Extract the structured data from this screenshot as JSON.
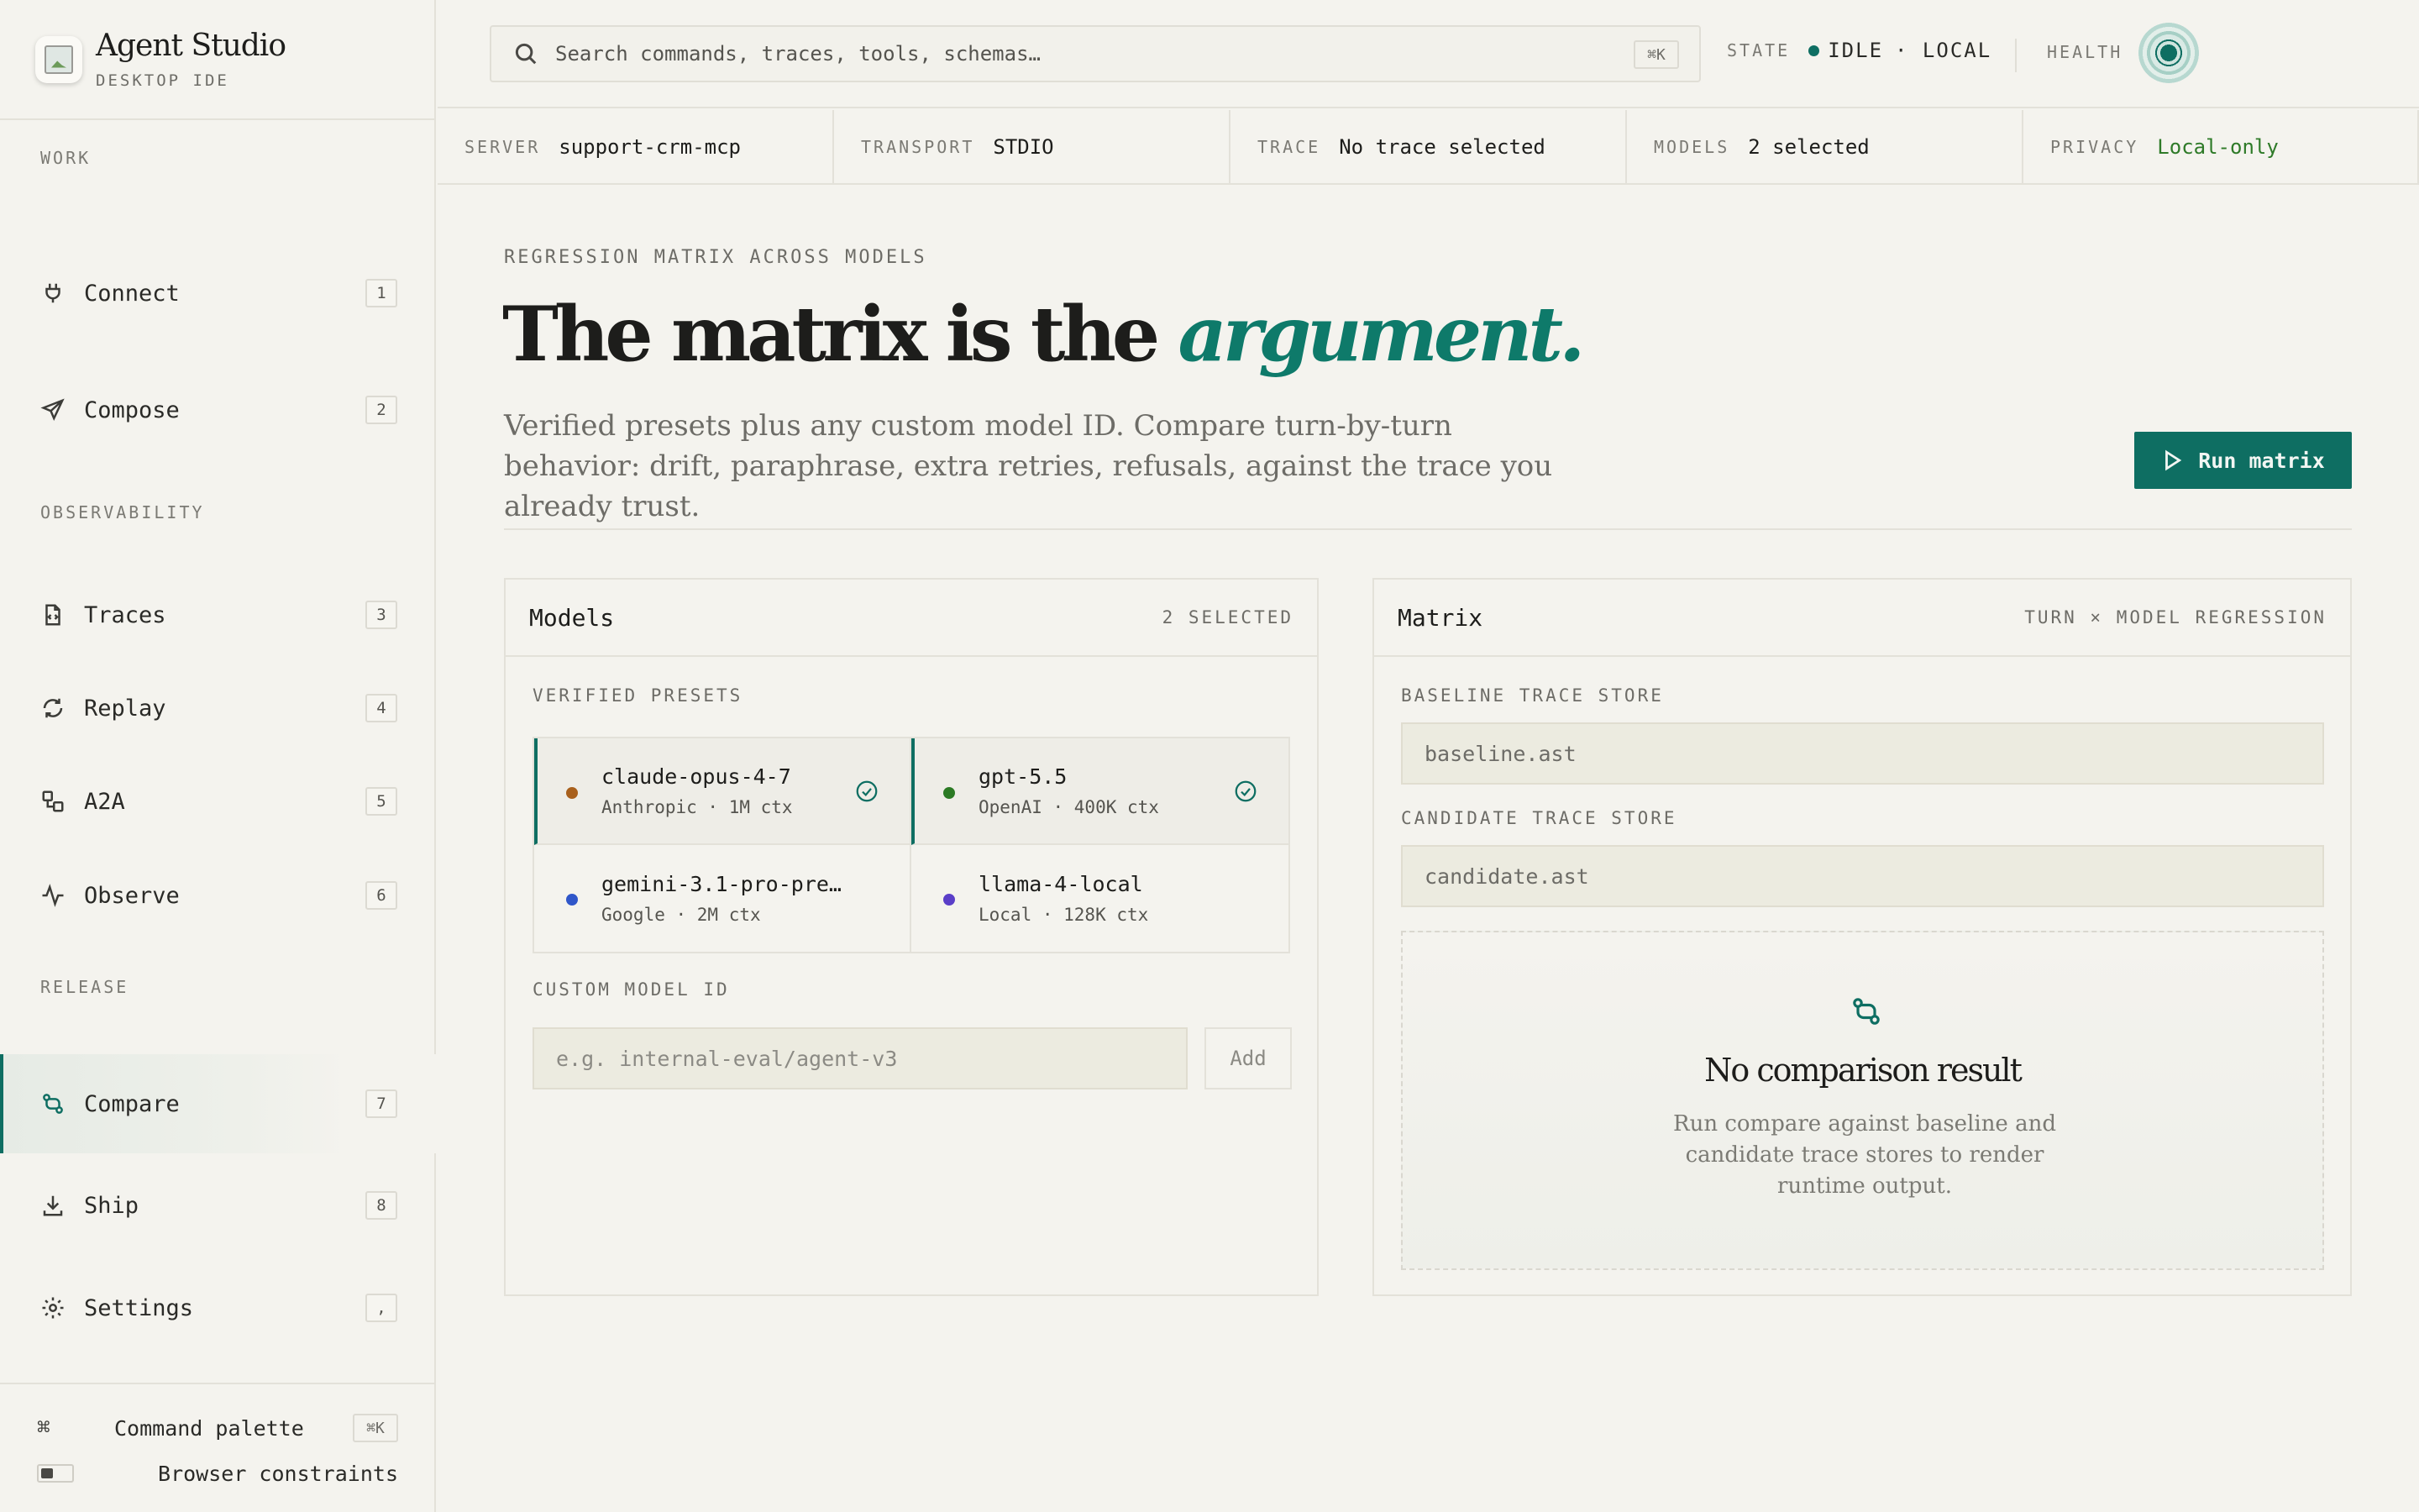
{
  "app": {
    "title": "Agent Studio",
    "subtitle": "DESKTOP IDE"
  },
  "sidebar": {
    "sections": {
      "work": "WORK",
      "observability": "OBSERVABILITY",
      "release": "RELEASE"
    },
    "items": [
      {
        "label": "Connect",
        "key": "1",
        "icon": "plug-icon"
      },
      {
        "label": "Compose",
        "key": "2",
        "icon": "send-icon"
      },
      {
        "label": "Traces",
        "key": "3",
        "icon": "file-code-icon"
      },
      {
        "label": "Replay",
        "key": "4",
        "icon": "refresh-icon"
      },
      {
        "label": "A2A",
        "key": "5",
        "icon": "a2a-shapes-icon"
      },
      {
        "label": "Observe",
        "key": "6",
        "icon": "pulse-icon"
      },
      {
        "label": "Compare",
        "key": "7",
        "icon": "git-compare-icon",
        "active": true
      },
      {
        "label": "Ship",
        "key": "8",
        "icon": "download-icon"
      },
      {
        "label": "Settings",
        "key": ",",
        "icon": "gear-icon"
      }
    ],
    "footer": {
      "command_palette": "Command palette",
      "command_key": "⌘K",
      "browser_constraints": "Browser constraints",
      "browser_constraints_on": false
    }
  },
  "topbar": {
    "search_placeholder": "Search commands, traces, tools, schemas…",
    "search_key": "⌘K",
    "state_label": "STATE",
    "state_value": "IDLE",
    "state_mode": "· LOCAL",
    "health_label": "HEALTH"
  },
  "context": [
    {
      "label": "SERVER",
      "value": "support-crm-mcp"
    },
    {
      "label": "TRANSPORT",
      "value": "STDIO"
    },
    {
      "label": "TRACE",
      "value": "No trace selected"
    },
    {
      "label": "MODELS",
      "value": "2 selected"
    },
    {
      "label": "PRIVACY",
      "value": "Local-only"
    }
  ],
  "main": {
    "kicker": "REGRESSION MATRIX ACROSS MODELS",
    "headline_plain": "The matrix is the ",
    "headline_em": "argument.",
    "lede": "Verified presets plus any custom model ID. Compare turn-by-turn behavior: drift, paraphrase, extra retries, refusals, against the trace you already trust.",
    "run_label": "Run matrix"
  },
  "models_panel": {
    "title": "Models",
    "meta": "2 SELECTED",
    "presets_label": "VERIFIED PRESETS",
    "presets": [
      {
        "name": "claude-opus-4-7",
        "meta": "Anthropic · 1M ctx",
        "dot": "#a8601c",
        "selected": true
      },
      {
        "name": "gpt-5.5",
        "meta": "OpenAI · 400K ctx",
        "dot": "#2b7a24",
        "selected": true
      },
      {
        "name": "gemini-3.1-pro-pre…",
        "meta": "Google · 2M ctx",
        "dot": "#2f56c9",
        "selected": false
      },
      {
        "name": "llama-4-local",
        "meta": "Local · 128K ctx",
        "dot": "#5a3ec8",
        "selected": false
      }
    ],
    "custom_label": "CUSTOM MODEL ID",
    "custom_placeholder": "e.g. internal-eval/agent-v3",
    "add_label": "Add"
  },
  "matrix_panel": {
    "title": "Matrix",
    "meta": "TURN × MODEL REGRESSION",
    "baseline_label": "BASELINE TRACE STORE",
    "baseline_value": "baseline.ast",
    "candidate_label": "CANDIDATE TRACE STORE",
    "candidate_value": "candidate.ast",
    "empty_title": "No comparison result",
    "empty_text": "Run compare against baseline and candidate trace stores to render runtime output."
  },
  "colors": {
    "accent": "#0e6e62",
    "accent_text": "#0e7a6a",
    "background": "#f4f3ee",
    "state_dot": "#0e6e62",
    "privacy": "#2e7a28"
  }
}
